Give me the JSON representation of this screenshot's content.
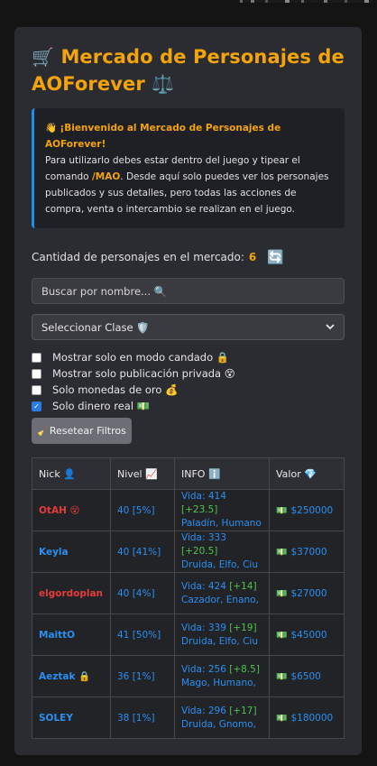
{
  "page": {
    "title": "Mercado de Personajes de AOForever",
    "title_icon_left": "🛒",
    "title_icon_right": "⚖️"
  },
  "info": {
    "wave": "👋",
    "welcome": "¡Bienvenido al Mercado de Personajes de AOForever!",
    "text_before_cmd": "Para utilizarlo debes estar dentro del juego y tipear el comando",
    "command": "/MAO",
    "text_after_cmd": ". Desde aquí solo puedes ver los personajes publicados y sus detalles, pero todas las acciones de compra, venta o intercambio se realizan en el juego."
  },
  "count": {
    "label": "Cantidad de personajes en el mercado:",
    "value": "6",
    "refresh_icon": "🔄"
  },
  "search": {
    "placeholder": "Buscar por nombre... 🔍"
  },
  "class_select": {
    "selected": "Seleccionar Clase 🛡️"
  },
  "filters": [
    {
      "label": "Mostrar solo en modo candado 🔒",
      "checked": false
    },
    {
      "label": "Mostrar solo publicación privada 😵",
      "checked": false
    },
    {
      "label": "Solo monedas de oro 💰",
      "checked": false
    },
    {
      "label": "Solo dinero real 💵",
      "checked": true
    }
  ],
  "reset_button": {
    "icon": "🧹",
    "label": "Resetear Filtros"
  },
  "table": {
    "headers": {
      "nick": "Nick 👤",
      "nivel": "Nivel 📈",
      "info": "INFO ℹ️",
      "valor": "Valor 💎"
    },
    "rows": [
      {
        "nick": "OtAH 😵",
        "nick_color": "#e53b3b",
        "nivel": "40 [5%]",
        "vida": "Vida: 414",
        "gain": "[+23.5]",
        "info2": "Paladín, Humano",
        "valor": "$250000"
      },
      {
        "nick": "Keyla",
        "nick_color": "#2a8ff0",
        "nivel": "40 [41%]",
        "vida": "Vida: 333",
        "gain": "[+20.5]",
        "info2": "Druida, Elfo, Ciu",
        "valor": "$37000"
      },
      {
        "nick": "elgordoplan",
        "nick_color": "#e53b3b",
        "nivel": "40 [4%]",
        "vida": "Vida: 424",
        "gain": "[+14]",
        "info2": "Cazador, Enano,",
        "valor": "$27000"
      },
      {
        "nick": "MaittO",
        "nick_color": "#2a8ff0",
        "nivel": "41 [50%]",
        "vida": "Vida: 339",
        "gain": "[+19]",
        "info2": "Druida, Elfo, Ciu",
        "valor": "$45000"
      },
      {
        "nick": "Aeztak 🔒",
        "nick_color": "#2a8ff0",
        "nivel": "36 [1%]",
        "vida": "Vida: 256",
        "gain": "[+8.5]",
        "info2": "Mago, Humano,",
        "valor": "$6500"
      },
      {
        "nick": "SOLEY",
        "nick_color": "#2a8ff0",
        "nivel": "38 [1%]",
        "vida": "Vida: 296",
        "gain": "[+17]",
        "info2": "Druida, Gnomo,",
        "valor": "$180000"
      }
    ],
    "money_icon": "💵"
  },
  "colors": {
    "accent": "#f3a30c",
    "link": "#2a8ff0",
    "red": "#e53b3b",
    "green": "#4cc24c"
  }
}
